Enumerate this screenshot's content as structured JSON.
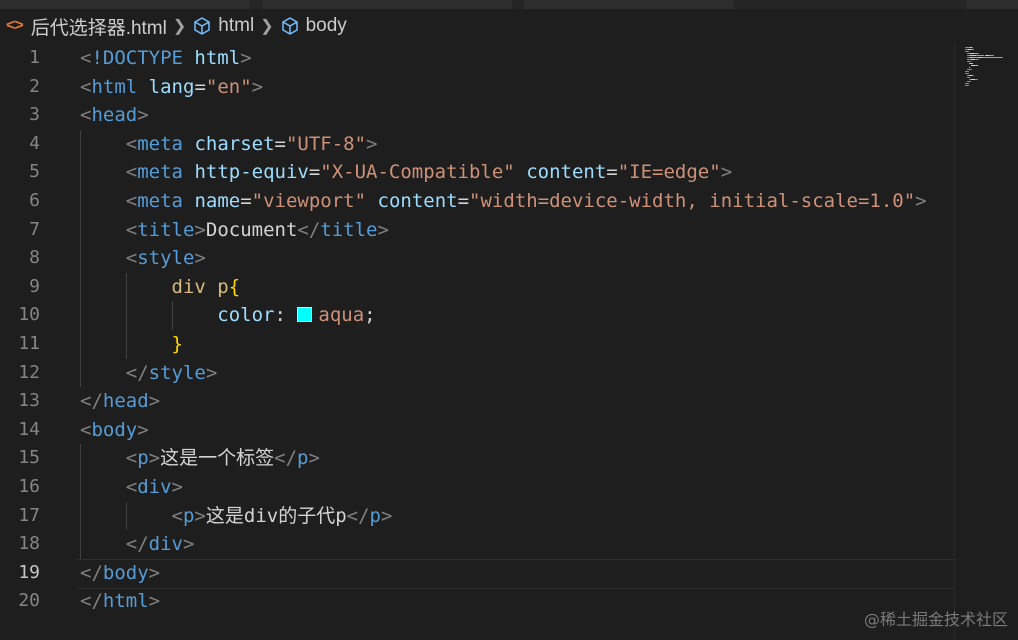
{
  "breadcrumb": {
    "file": "后代选择器.html",
    "items": [
      "html",
      "body"
    ]
  },
  "editor": {
    "active_line": 19,
    "lines": [
      {
        "n": "1",
        "tokens": [
          [
            "punct",
            "<"
          ],
          [
            "tag",
            "!DOCTYPE"
          ],
          [
            "text",
            " "
          ],
          [
            "attr",
            "html"
          ],
          [
            "punct",
            ">"
          ]
        ]
      },
      {
        "n": "2",
        "tokens": [
          [
            "punct",
            "<"
          ],
          [
            "tag",
            "html"
          ],
          [
            "text",
            " "
          ],
          [
            "attr",
            "lang"
          ],
          [
            "text",
            "="
          ],
          [
            "str",
            "\"en\""
          ],
          [
            "punct",
            ">"
          ]
        ]
      },
      {
        "n": "3",
        "tokens": [
          [
            "punct",
            "<"
          ],
          [
            "tag",
            "head"
          ],
          [
            "punct",
            ">"
          ]
        ]
      },
      {
        "n": "4",
        "tokens": [
          [
            "text",
            "    "
          ],
          [
            "punct",
            "<"
          ],
          [
            "tag",
            "meta"
          ],
          [
            "text",
            " "
          ],
          [
            "attr",
            "charset"
          ],
          [
            "text",
            "="
          ],
          [
            "str",
            "\"UTF-8\""
          ],
          [
            "punct",
            ">"
          ]
        ]
      },
      {
        "n": "5",
        "tokens": [
          [
            "text",
            "    "
          ],
          [
            "punct",
            "<"
          ],
          [
            "tag",
            "meta"
          ],
          [
            "text",
            " "
          ],
          [
            "attr",
            "http-equiv"
          ],
          [
            "text",
            "="
          ],
          [
            "str",
            "\"X-UA-Compatible\""
          ],
          [
            "text",
            " "
          ],
          [
            "attr",
            "content"
          ],
          [
            "text",
            "="
          ],
          [
            "str",
            "\"IE=edge\""
          ],
          [
            "punct",
            ">"
          ]
        ]
      },
      {
        "n": "6",
        "tokens": [
          [
            "text",
            "    "
          ],
          [
            "punct",
            "<"
          ],
          [
            "tag",
            "meta"
          ],
          [
            "text",
            " "
          ],
          [
            "attr",
            "name"
          ],
          [
            "text",
            "="
          ],
          [
            "str",
            "\"viewport\""
          ],
          [
            "text",
            " "
          ],
          [
            "attr",
            "content"
          ],
          [
            "text",
            "="
          ],
          [
            "str",
            "\"width=device-width, initial-scale=1.0\""
          ],
          [
            "punct",
            ">"
          ]
        ]
      },
      {
        "n": "7",
        "tokens": [
          [
            "text",
            "    "
          ],
          [
            "punct",
            "<"
          ],
          [
            "tag",
            "title"
          ],
          [
            "punct",
            ">"
          ],
          [
            "text",
            "Document"
          ],
          [
            "punct",
            "</"
          ],
          [
            "tag",
            "title"
          ],
          [
            "punct",
            ">"
          ]
        ]
      },
      {
        "n": "8",
        "tokens": [
          [
            "text",
            "    "
          ],
          [
            "punct",
            "<"
          ],
          [
            "tag",
            "style"
          ],
          [
            "punct",
            ">"
          ]
        ]
      },
      {
        "n": "9",
        "tokens": [
          [
            "text",
            "        "
          ],
          [
            "sel",
            "div p"
          ],
          [
            "brace",
            "{"
          ]
        ]
      },
      {
        "n": "10",
        "tokens": [
          [
            "text",
            "            "
          ],
          [
            "attr",
            "color"
          ],
          [
            "text",
            ": "
          ],
          [
            "swatch",
            ""
          ],
          [
            "str",
            "aqua"
          ],
          [
            "text",
            ";"
          ]
        ]
      },
      {
        "n": "11",
        "tokens": [
          [
            "text",
            "        "
          ],
          [
            "brace",
            "}"
          ]
        ]
      },
      {
        "n": "12",
        "tokens": [
          [
            "text",
            "    "
          ],
          [
            "punct",
            "</"
          ],
          [
            "tag",
            "style"
          ],
          [
            "punct",
            ">"
          ]
        ]
      },
      {
        "n": "13",
        "tokens": [
          [
            "punct",
            "</"
          ],
          [
            "tag",
            "head"
          ],
          [
            "punct",
            ">"
          ]
        ]
      },
      {
        "n": "14",
        "tokens": [
          [
            "punct",
            "<"
          ],
          [
            "tag",
            "body"
          ],
          [
            "punct",
            ">"
          ]
        ]
      },
      {
        "n": "15",
        "tokens": [
          [
            "text",
            "    "
          ],
          [
            "punct",
            "<"
          ],
          [
            "tag",
            "p"
          ],
          [
            "punct",
            ">"
          ],
          [
            "text",
            "这是一个标签"
          ],
          [
            "punct",
            "</"
          ],
          [
            "tag",
            "p"
          ],
          [
            "punct",
            ">"
          ]
        ]
      },
      {
        "n": "16",
        "tokens": [
          [
            "text",
            "    "
          ],
          [
            "punct",
            "<"
          ],
          [
            "tag",
            "div"
          ],
          [
            "punct",
            ">"
          ]
        ]
      },
      {
        "n": "17",
        "tokens": [
          [
            "text",
            "        "
          ],
          [
            "punct",
            "<"
          ],
          [
            "tag",
            "p"
          ],
          [
            "punct",
            ">"
          ],
          [
            "text",
            "这是div的子代p"
          ],
          [
            "punct",
            "</"
          ],
          [
            "tag",
            "p"
          ],
          [
            "punct",
            ">"
          ]
        ]
      },
      {
        "n": "18",
        "tokens": [
          [
            "text",
            "    "
          ],
          [
            "punct",
            "</"
          ],
          [
            "tag",
            "div"
          ],
          [
            "punct",
            ">"
          ]
        ]
      },
      {
        "n": "19",
        "tokens": [
          [
            "punct",
            "</"
          ],
          [
            "tag",
            "body"
          ],
          [
            "punct",
            ">"
          ]
        ]
      },
      {
        "n": "20",
        "tokens": [
          [
            "punct",
            "</"
          ],
          [
            "tag",
            "html"
          ],
          [
            "punct",
            ">"
          ]
        ]
      }
    ]
  },
  "watermark": "@稀土掘金技术社区",
  "colors": {
    "background": "#1e1e1e",
    "tag": "#569cd6",
    "attribute": "#9cdcfe",
    "string": "#ce9178",
    "selector": "#d7ba7d",
    "brace": "#ffd700",
    "swatch": "#00ffff"
  }
}
